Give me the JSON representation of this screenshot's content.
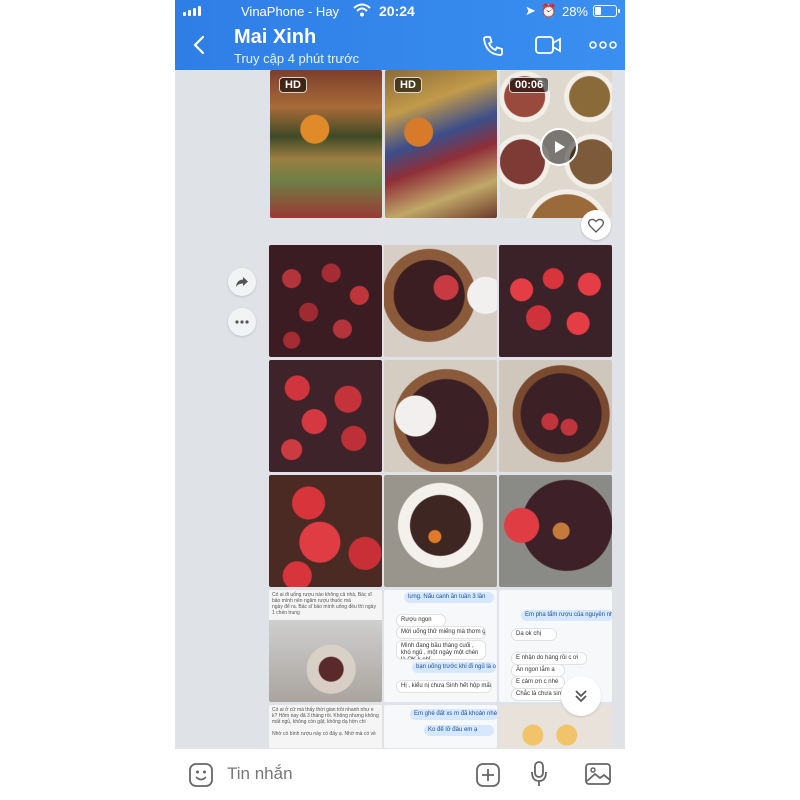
{
  "status_bar": {
    "carrier": "VinaPhone - Hay",
    "time": "20:24",
    "battery": "28%"
  },
  "header": {
    "name": "Mai Xinh",
    "subtitle": "Truy cập 4 phút trước"
  },
  "media": {
    "badge_1": "HD",
    "badge_2": "HD",
    "video_duration": "00:06"
  },
  "screenshots": {
    "s1_text1": "Có ai đi uống rượu nào không cả nhà, Bác sĩ bảo mình nên ngâm rượu thuốc mà",
    "s1_text2": "mấy cái này ăn như vậy thì uống được luôn, ba nên có ý mua",
    "s1_text3": "ngày để ra. Bác sĩ bảo mình uống đều thì ngày 1 chén trung",
    "s2_b1": "lưng. Nấu canh ăn tuần 3 lần",
    "s2_b2": "Rượu ngon",
    "s2_b3": "Mới uống thử miếng mà thơm ghê",
    "s2_b4": "Mình đang bầu tháng cuối , khó ngủ , một ngày một chén là OK k nhỉ",
    "s2_b5": "bạn uống trước khi đi ngủ là ok nhé",
    "s2_b6": "Hị , kiểu nị chưa Sinh hết hộp mất",
    "s3_b1": "Em pha tẩm rượu của nguyên nhé",
    "s3_b2": "Dạ ok chị",
    "s3_b3": "E nhận do hàng rồi c ơi",
    "s3_b4": "Ăn ngon lắm a",
    "s3_b5": "E cảm ơn c nhé",
    "s3_b6": "Chắc là chưa sinh r nấy rồi :))",
    "s4_text": "Có ai ở cữ mà thấy thời gian trôi nhanh như e k? Hôm nay đã 3 tháng rồi. Không nhưng không mất ngủ, không còn gặt, không dạ hờn chi",
    "s4_text2": "Nhờ có bình rượu này có đấy ạ. Nhờ mà có về",
    "s5_b1": "Em ghé đất xs m đã khoản nhé",
    "s5_b2": "Ko để lỡ đâu em ạ"
  },
  "composer": {
    "placeholder": "Tin nhắn"
  },
  "colors": {
    "header": "#2f7ee6",
    "background": "#dfe2e7"
  },
  "icons": [
    "signal-icon",
    "wifi-icon",
    "back-icon",
    "phone-icon",
    "video-call-icon",
    "more-icon",
    "share-icon",
    "more-options-icon",
    "heart-icon",
    "play-icon",
    "scroll-down-icon",
    "sticker-icon",
    "add-icon",
    "microphone-icon",
    "image-icon"
  ]
}
